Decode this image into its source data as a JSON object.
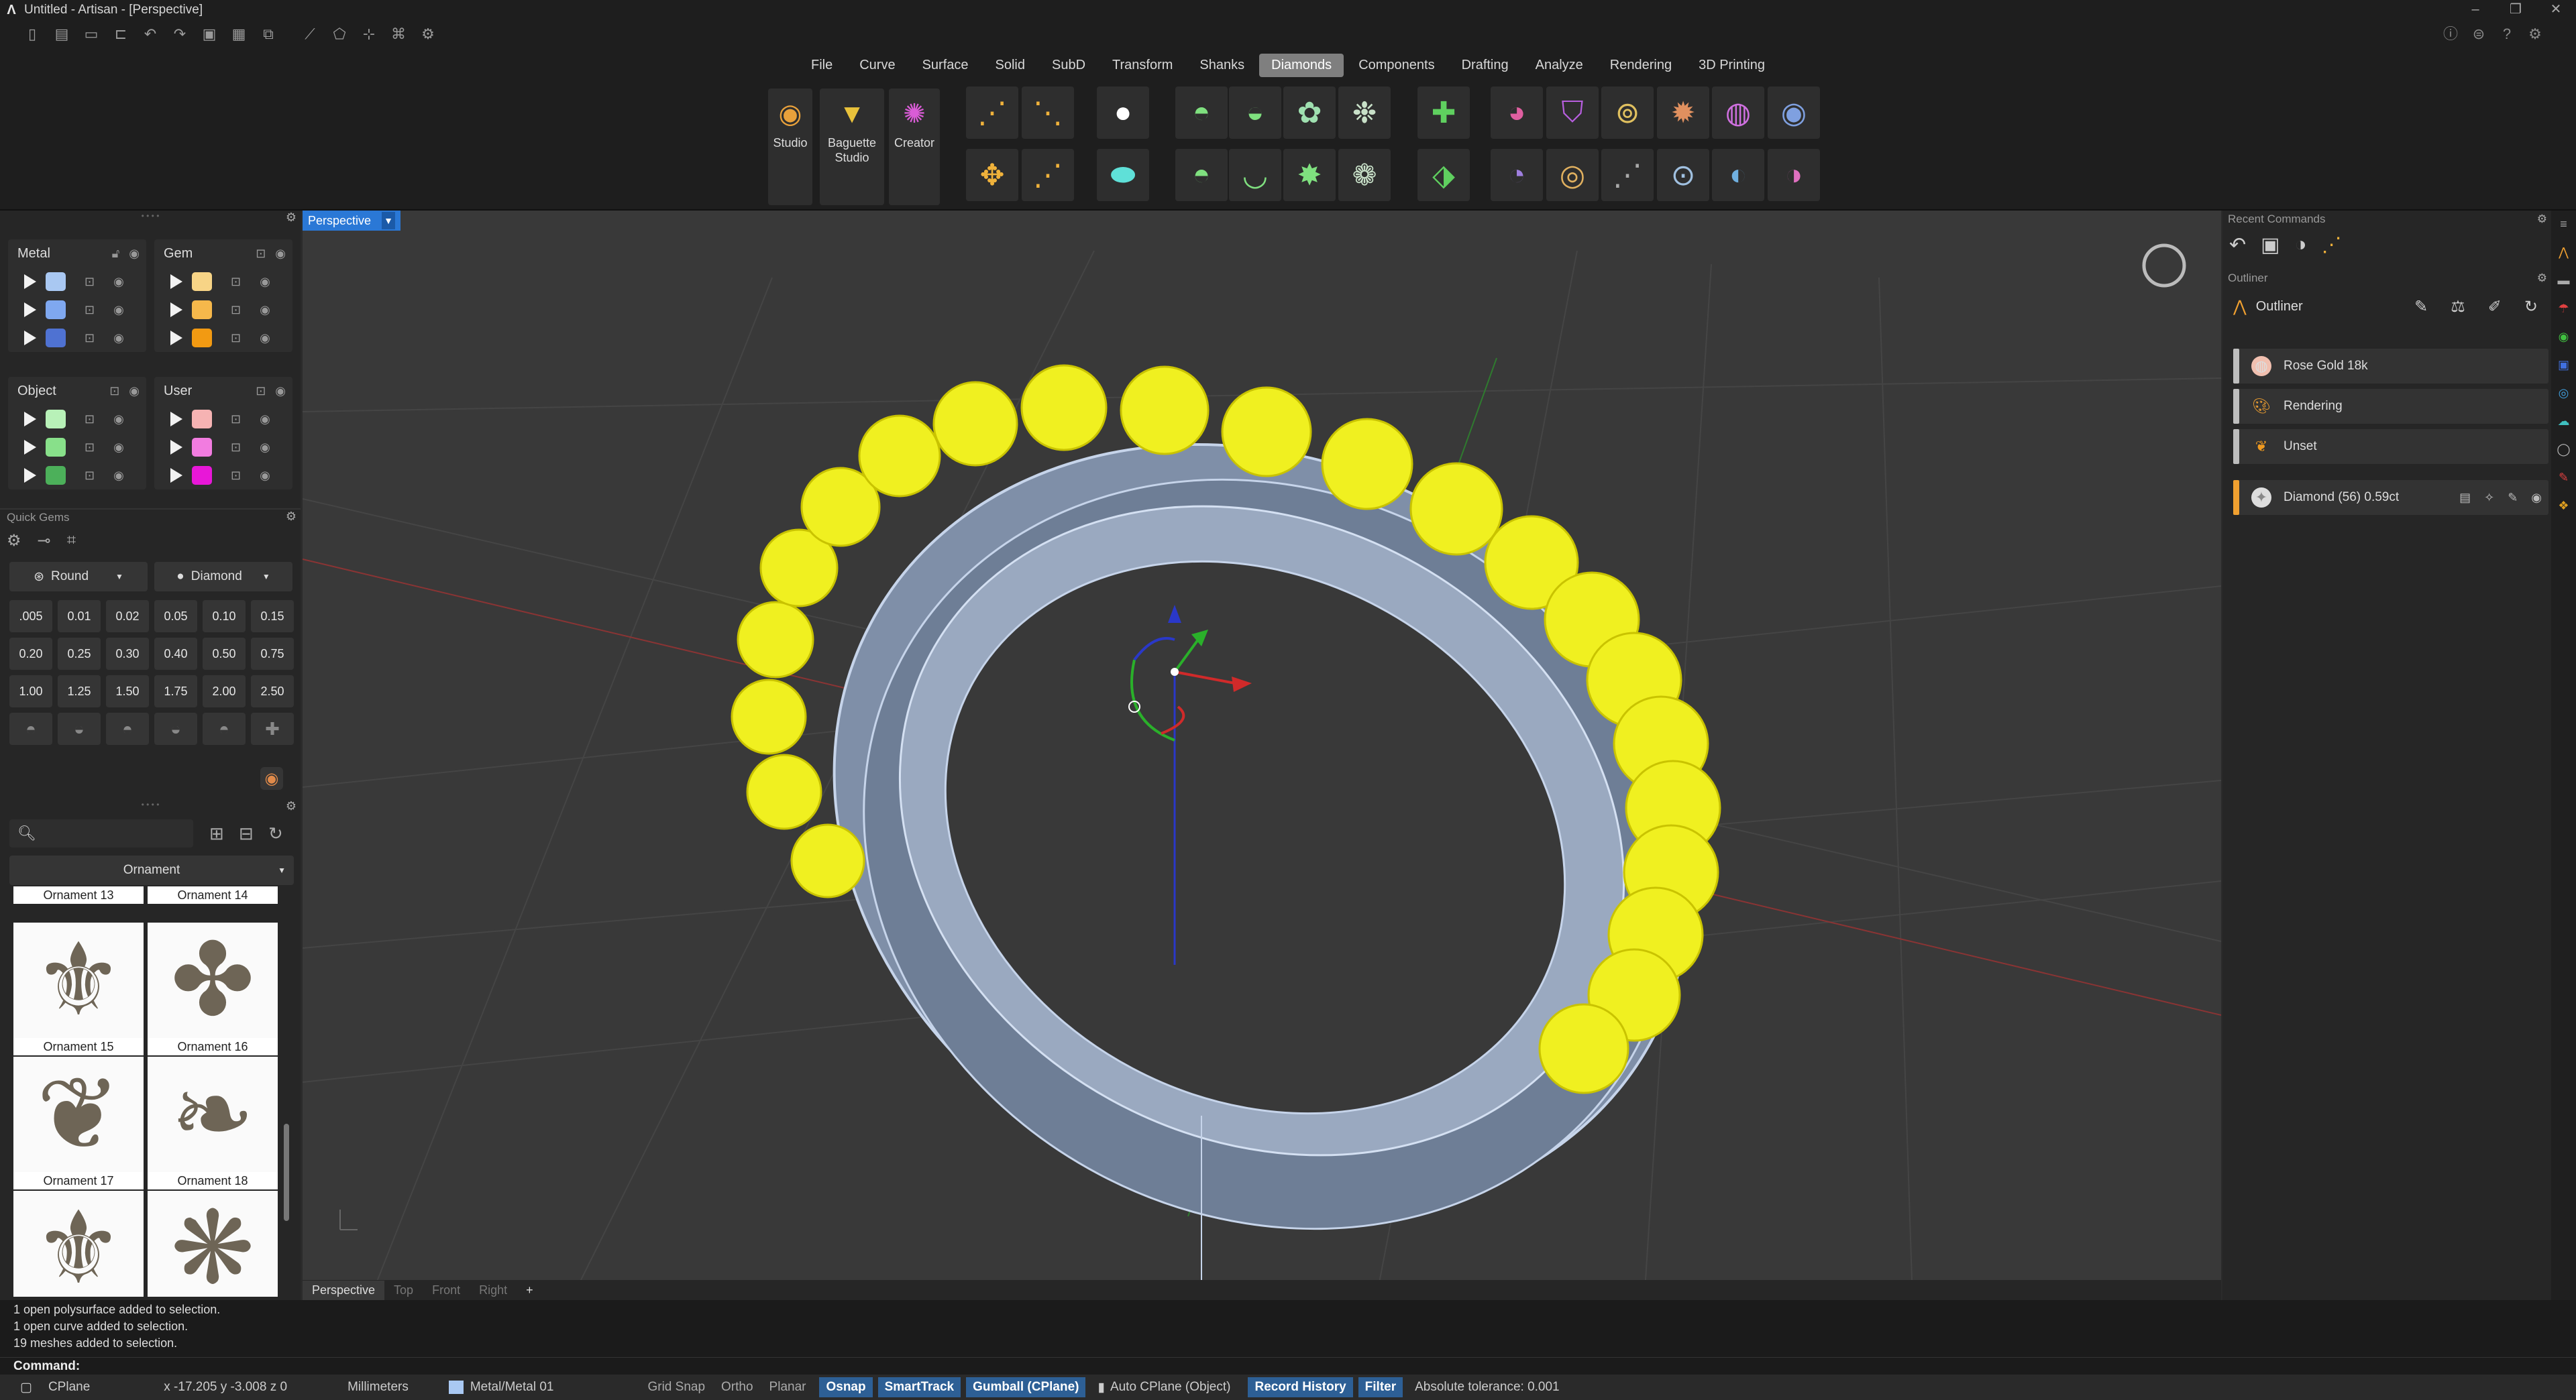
{
  "window": {
    "title": "Untitled - Artisan - [Perspective]",
    "controls": [
      "–",
      "❐",
      "✕"
    ]
  },
  "menu": [
    "File",
    "Curve",
    "Surface",
    "Solid",
    "SubD",
    "Transform",
    "Shanks",
    "Diamonds",
    "Components",
    "Drafting",
    "Analyze",
    "Rendering",
    "3D Printing"
  ],
  "active_menu": "Diamonds",
  "ribbon": {
    "studio": "Studio",
    "baguette_studio": "Baguette Studio",
    "creator": "Creator"
  },
  "layers": {
    "metal": {
      "title": "Metal",
      "colors": [
        "#a9c8f2",
        "#7fa8f0",
        "#4f72d2"
      ]
    },
    "gem": {
      "title": "Gem",
      "colors": [
        "#f7d486",
        "#f6b84b",
        "#f29a12"
      ]
    },
    "object": {
      "title": "Object",
      "colors": [
        "#b8f1b8",
        "#88e08a",
        "#4cb05a"
      ]
    },
    "user": {
      "title": "User",
      "colors": [
        "#f6b3b3",
        "#f27ce0",
        "#e817d8"
      ]
    }
  },
  "quick_gems": {
    "title": "Quick Gems",
    "shape": "Round",
    "material": "Diamond",
    "sizes": [
      ".005",
      "0.01",
      "0.02",
      "0.05",
      "0.10",
      "0.15",
      "0.20",
      "0.25",
      "0.30",
      "0.40",
      "0.50",
      "0.75",
      "1.00",
      "1.25",
      "1.50",
      "1.75",
      "2.00",
      "2.50"
    ]
  },
  "library": {
    "category": "Ornament",
    "items": [
      "Ornament 13",
      "Ornament 14",
      "Ornament 15",
      "Ornament 16",
      "Ornament 17",
      "Ornament 18"
    ]
  },
  "viewport": {
    "name": "Perspective",
    "tabs": [
      "Perspective",
      "Top",
      "Front",
      "Right",
      "+"
    ]
  },
  "right_panel": {
    "recent_title": "Recent Commands",
    "outliner_title": "Outliner",
    "outliner_label": "Outliner",
    "rows": [
      "Rose Gold 18k",
      "Rendering",
      "Unset"
    ],
    "diamond_row": "Diamond (56) 0.59ct"
  },
  "command_history": [
    "1 open polysurface added to selection.",
    "1 open curve added to selection.",
    "19 meshes added to selection."
  ],
  "command_prompt": "Command:",
  "status": {
    "cplane": "CPlane",
    "coords": "x -17.205  y -3.008  z 0",
    "units": "Millimeters",
    "layer": "Metal/Metal 01",
    "grid_snap": "Grid Snap",
    "ortho": "Ortho",
    "planar": "Planar",
    "osnap": "Osnap",
    "smarttrack": "SmartTrack",
    "gumball": "Gumball (CPlane)",
    "auto_cplane": "Auto CPlane (Object)",
    "record_history": "Record History",
    "filter": "Filter",
    "tolerance": "Absolute tolerance: 0.001"
  }
}
